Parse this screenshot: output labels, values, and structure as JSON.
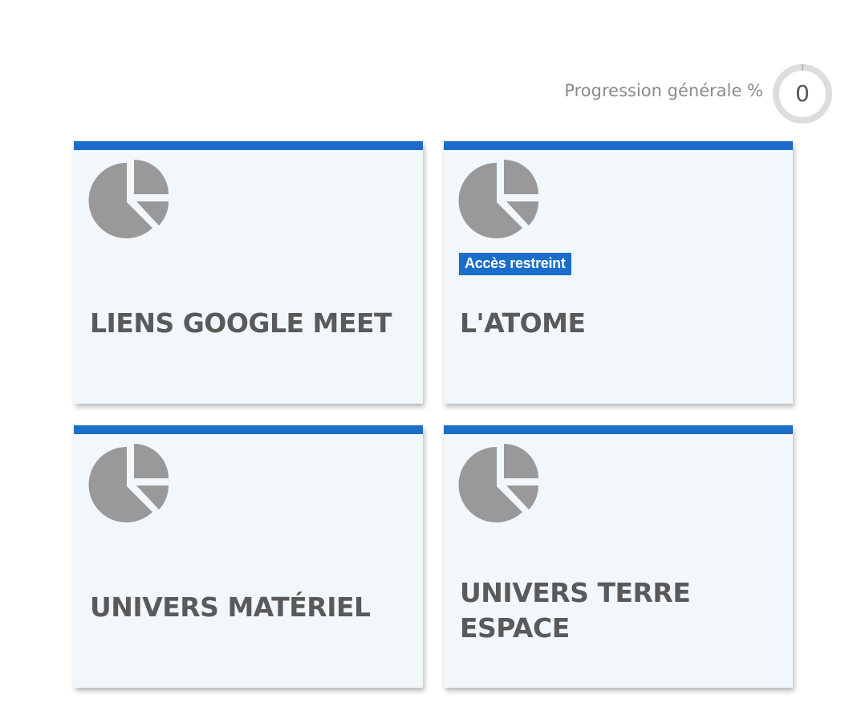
{
  "progress": {
    "label": "Progression générale %",
    "value": "0",
    "percent": 0
  },
  "colors": {
    "accent": "#1a6ec9",
    "card_bg": "#f2f7fb",
    "icon": "#999999",
    "title": "#5a5a5a",
    "ring": "#dddddd"
  },
  "cards": [
    {
      "icon": "pie-chart-icon",
      "title": "LIENS GOOGLE MEET",
      "badge": ""
    },
    {
      "icon": "pie-chart-icon",
      "title": "L'ATOME",
      "badge": "Accès restreint"
    },
    {
      "icon": "pie-chart-icon",
      "title": "UNIVERS MATÉRIEL",
      "badge": ""
    },
    {
      "icon": "pie-chart-icon",
      "title": "UNIVERS TERRE ESPACE",
      "badge": ""
    }
  ]
}
